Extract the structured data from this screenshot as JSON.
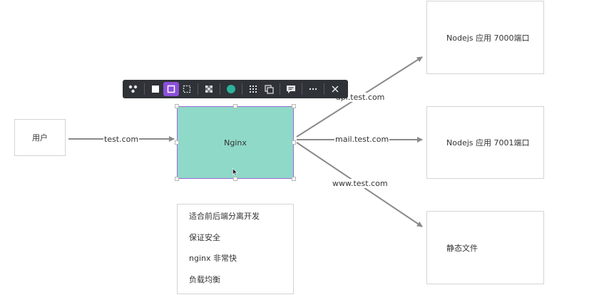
{
  "nodes": {
    "user": "用户",
    "nginx": "Nginx",
    "node1": "Nodejs 应用 7000端口",
    "node2": "Nodejs 应用 7001端口",
    "static": "静态文件"
  },
  "edges": {
    "user_to_nginx": "test.com",
    "to_node1": "api.test.com",
    "to_node2": "mail.test.com",
    "to_static": "www.test.com"
  },
  "notes": [
    "适合前后端分离开发",
    "保证安全",
    "nginx 非常快",
    "负载均衡"
  ],
  "colors": {
    "nginx_fill": "#8fd9c8",
    "selection": "#9b6bd6",
    "edge": "#8a8a8a",
    "toolbar_bg": "#2f3338",
    "toolbar_active": "#8b4fd9",
    "color_swatch": "#2bb39a"
  },
  "toolbar": {
    "tools": [
      "shape-menu-icon",
      "fill-square-icon",
      "outline-square-icon",
      "dashed-square-icon",
      "transparency-icon",
      "color-swatch-icon",
      "grid-dots-icon",
      "duplicate-icon",
      "comment-icon",
      "more-icon",
      "close-icon"
    ],
    "active": "outline-square-icon"
  }
}
